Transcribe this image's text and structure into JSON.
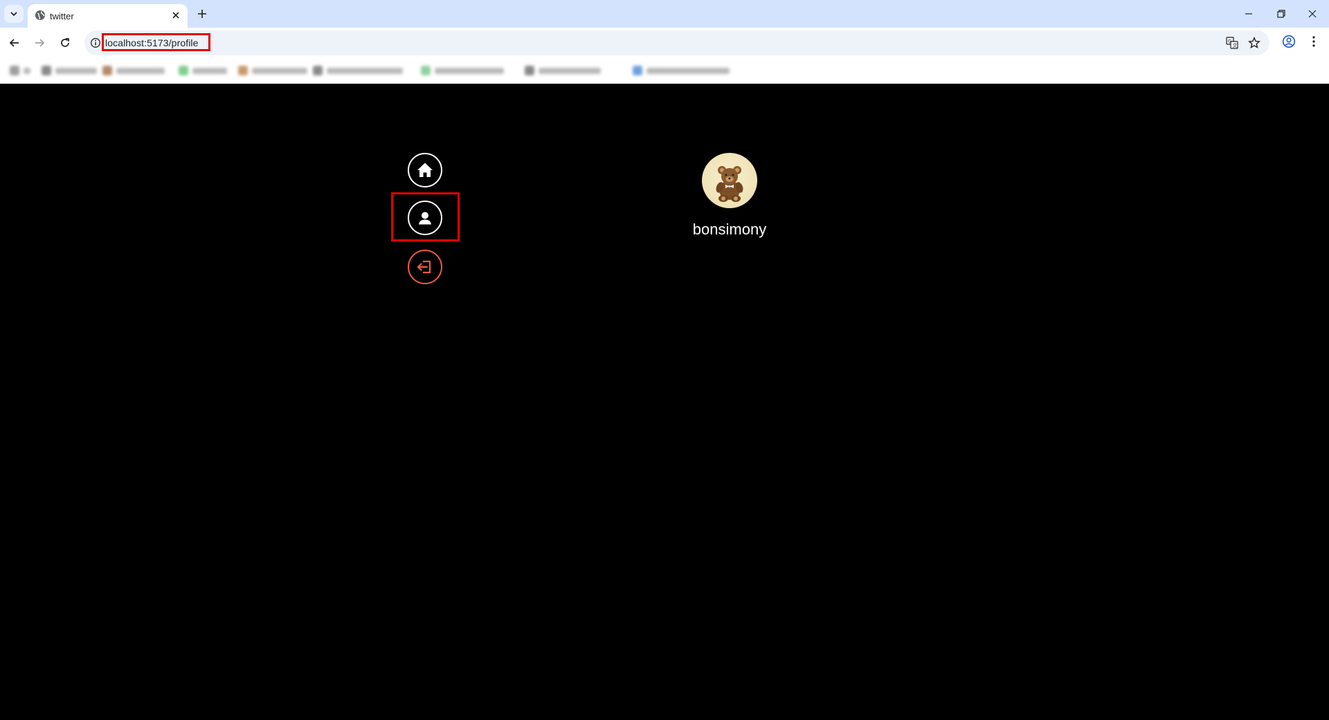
{
  "browser": {
    "tab_title": "twitter",
    "url": "localhost:5173/profile",
    "bookmarks": [
      {
        "color": "#9e9e9e",
        "w": 10
      },
      {
        "color": "#8a8a8a",
        "w": 60
      },
      {
        "color": "#b48a6a",
        "w": 70
      },
      {
        "color": "#7fcf8f",
        "w": 50
      },
      {
        "color": "#c89a6a",
        "w": 80
      },
      {
        "color": "#8a8a8a",
        "w": 110
      },
      {
        "color": "#8fd0a0",
        "w": 100
      },
      {
        "color": "#8a8a8a",
        "w": 90
      },
      {
        "color": "#6fa0e0",
        "w": 120
      }
    ]
  },
  "sidebar": {
    "items": [
      {
        "name": "home",
        "icon": "home-icon",
        "color": "#ffffff"
      },
      {
        "name": "profile",
        "icon": "user-icon",
        "color": "#ffffff",
        "highlighted": true
      },
      {
        "name": "logout",
        "icon": "logout-icon",
        "color": "#f15b3e"
      }
    ]
  },
  "profile": {
    "username": "bonsimony",
    "avatar": "teddy-bear-avatar"
  },
  "colors": {
    "page_bg": "#000000",
    "accent_red": "#f15b3e",
    "highlight": "#e00000"
  }
}
